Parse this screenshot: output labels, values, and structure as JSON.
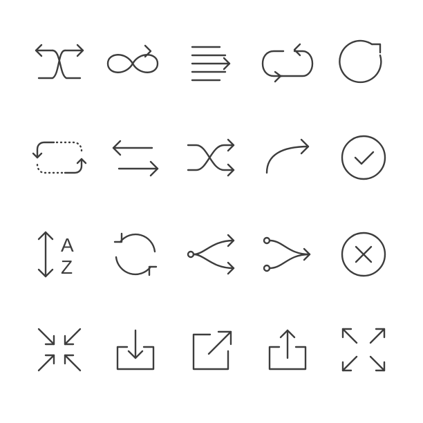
{
  "stroke_color": "#3d3d3d",
  "background": "#ffffff",
  "icons": [
    {
      "name": "shuffle-crossed-icon"
    },
    {
      "name": "infinity-loop-icon"
    },
    {
      "name": "text-align-arrow-icon"
    },
    {
      "name": "repeat-icon"
    },
    {
      "name": "refresh-clockwise-icon"
    },
    {
      "name": "repeat-dotted-icon"
    },
    {
      "name": "swap-arrows-icon"
    },
    {
      "name": "shuffle-icon"
    },
    {
      "name": "redo-curve-icon"
    },
    {
      "name": "check-circle-icon"
    },
    {
      "name": "sort-alphabetical-icon"
    },
    {
      "name": "rotate-arrows-icon"
    },
    {
      "name": "branch-split-icon"
    },
    {
      "name": "branch-merge-icon"
    },
    {
      "name": "close-circle-icon"
    },
    {
      "name": "collapse-icon"
    },
    {
      "name": "download-tray-icon"
    },
    {
      "name": "external-link-icon"
    },
    {
      "name": "upload-tray-icon"
    },
    {
      "name": "expand-icon"
    }
  ],
  "sort_labels": {
    "top": "A",
    "bottom": "Z"
  }
}
